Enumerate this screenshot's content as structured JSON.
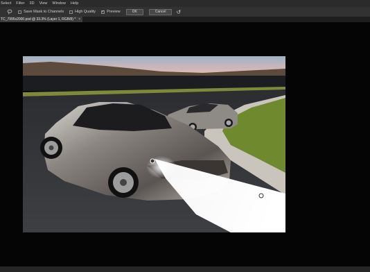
{
  "menubar": {
    "items": [
      "Select",
      "Filter",
      "3D",
      "View",
      "Window",
      "Help"
    ]
  },
  "options": {
    "save_mask_label": "Save Mask to Channels",
    "high_quality_label": "High Quality",
    "preview_label": "Preview",
    "ok_label": "OK",
    "cancel_label": "Cancel"
  },
  "tab": {
    "title": "TC_7995x2000.psd @ 33.3% (Layer 1, RGB/8) *",
    "close_glyph": "×"
  },
  "icons": {
    "tool": "lasso-tool-icon",
    "reset": "reset-icon",
    "checkmark": "check-icon"
  },
  "colors": {
    "menubar_bg": "#2b2b2b",
    "options_bg": "#323232",
    "canvas_bg": "#050505",
    "light_beam": "#ffffff"
  }
}
